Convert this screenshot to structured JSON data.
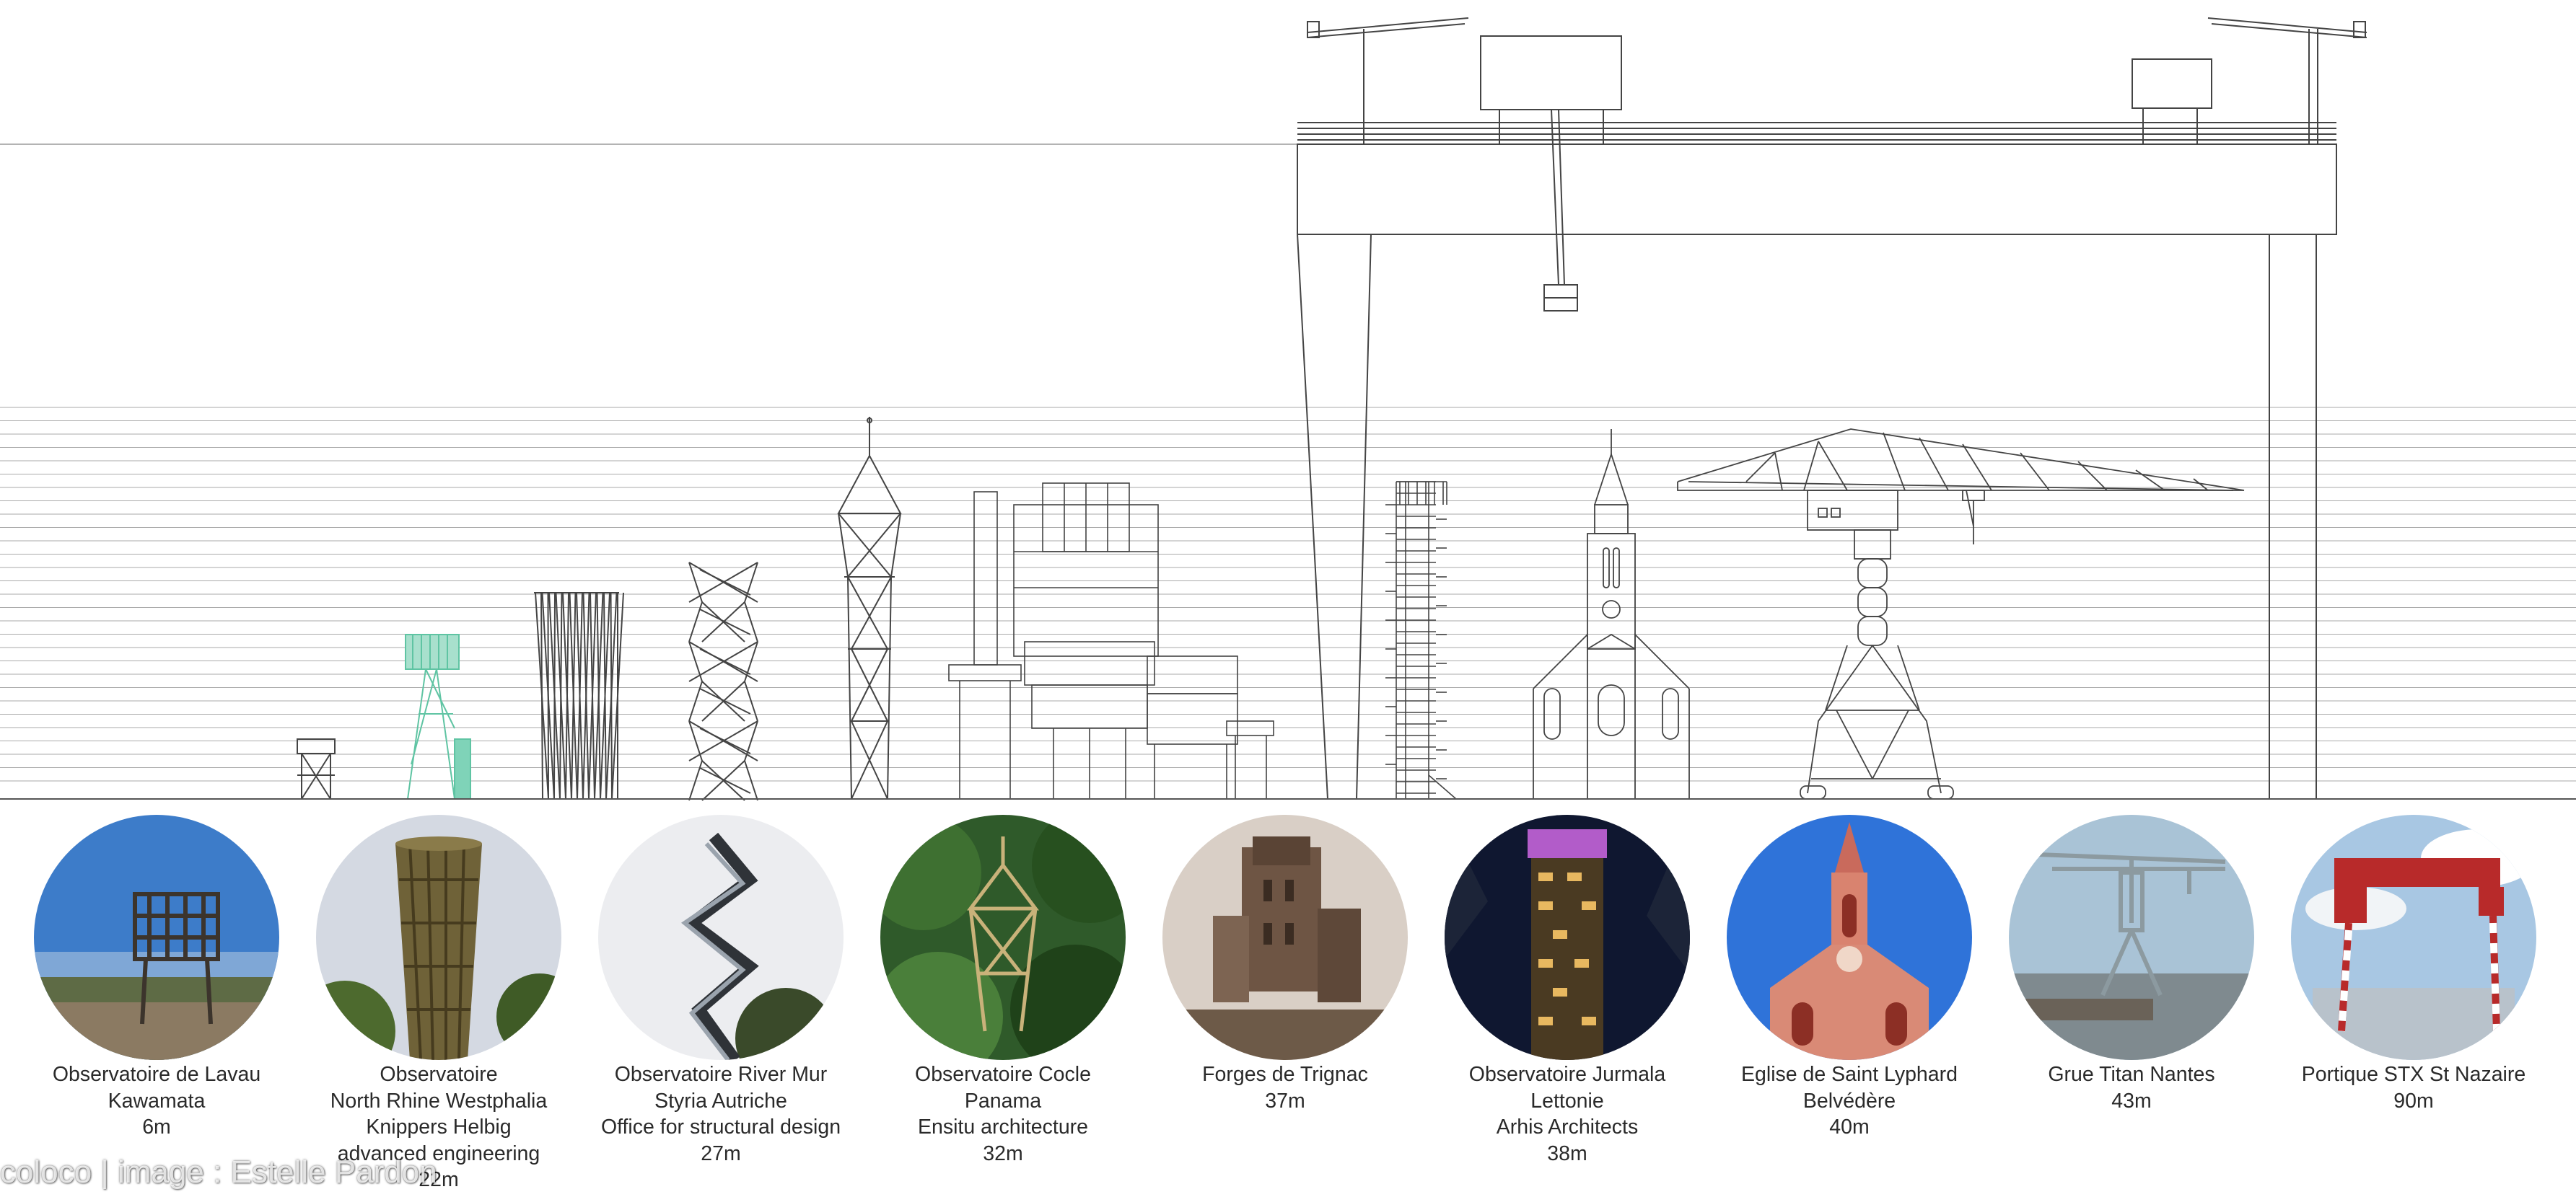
{
  "items": [
    {
      "lines": [
        "Observatoire de Lavau",
        "Kawamata",
        "6m"
      ],
      "photo_icon": "lavau-observatory-photo"
    },
    {
      "lines": [
        "Observatoire",
        "North Rhine Westphalia",
        "Knippers Helbig",
        "advanced engineering",
        "22m"
      ],
      "photo_icon": "north-rhine-westphalia-tower-photo"
    },
    {
      "lines": [
        "Observatoire River Mur",
        "Styria Autriche",
        "Office for structural design",
        "27m"
      ],
      "photo_icon": "river-mur-tower-photo"
    },
    {
      "lines": [
        "Observatoire Cocle",
        "Panama",
        "Ensitu architecture",
        "32m"
      ],
      "photo_icon": "cocle-tower-photo"
    },
    {
      "lines": [
        "Forges de Trignac",
        "37m"
      ],
      "photo_icon": "trignac-forges-photo"
    },
    {
      "lines": [
        "Observatoire Jurmala",
        "Lettonie",
        "Arhis Architects",
        "38m"
      ],
      "photo_icon": "jurmala-tower-photo"
    },
    {
      "lines": [
        "Eglise de Saint Lyphard",
        "Belvédère",
        "40m"
      ],
      "photo_icon": "saint-lyphard-church-photo"
    },
    {
      "lines": [
        "Grue Titan Nantes",
        "43m"
      ],
      "photo_icon": "titan-crane-photo"
    },
    {
      "lines": [
        "Portique STX St Nazaire",
        "90m"
      ],
      "photo_icon": "stx-gantry-photo"
    }
  ],
  "credit": "coloco | image : Estelle Pardon",
  "colors": {
    "line": "#444444",
    "grid": "#9a9a9a",
    "accent_green": "#5fc4a3",
    "sky_blue": "#3d7cc9",
    "forest_green": "#2f5a2a",
    "crane_red": "#b82a2a"
  }
}
